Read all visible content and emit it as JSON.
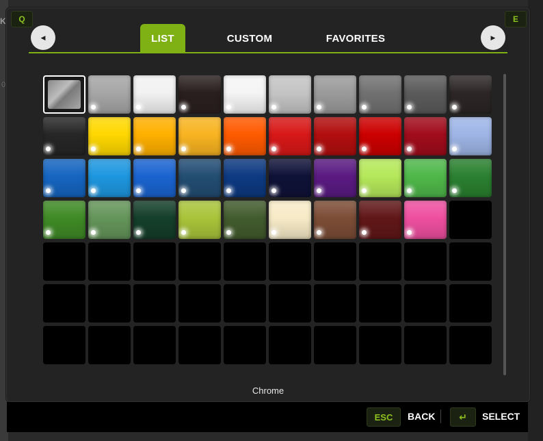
{
  "keys": {
    "prev": "Q",
    "next": "E"
  },
  "tabs": [
    {
      "label": "LIST",
      "active": true
    },
    {
      "label": "CUSTOM",
      "active": false
    },
    {
      "label": "FAVORITES",
      "active": false
    }
  ],
  "selected_color_name": "Chrome",
  "swatches": [
    "selected",
    "#a6a6a6",
    "#f2f2f2",
    "#2a1f1f",
    "#f5f5f5",
    "#c4c4c4",
    "#9b9b9b",
    "#717171",
    "#5b5b5b",
    "#2c2626",
    "#262626",
    "#ffd800",
    "#ffb000",
    "#f8b421",
    "#ff5a00",
    "#d81818",
    "#b20e0e",
    "#cc0000",
    "#a10c1c",
    "#9eb5e6",
    "#1565c0",
    "#1e97e0",
    "#1a64d0",
    "#234d73",
    "#0d3a82",
    "#0f1238",
    "#5a1a82",
    "#b5e85a",
    "#4fb84a",
    "#2a8030",
    "#3f8a26",
    "#64955a",
    "#143f2a",
    "#a9c43a",
    "#425b2d",
    "#f7ebc7",
    "#7c4d36",
    "#611717",
    "#ee4fa0",
    "empty",
    "empty",
    "empty",
    "empty",
    "empty",
    "empty",
    "empty",
    "empty",
    "empty",
    "empty",
    "empty",
    "empty",
    "empty",
    "empty",
    "empty",
    "empty",
    "empty",
    "empty",
    "empty",
    "empty",
    "empty",
    "empty",
    "empty",
    "empty",
    "empty",
    "empty",
    "empty",
    "empty",
    "empty",
    "empty",
    "empty"
  ],
  "footer": {
    "back_key": "ESC",
    "back_label": "BACK",
    "select_key_icon": "enter-key-icon",
    "select_label": "SELECT"
  },
  "accent_color": "#7fb115"
}
